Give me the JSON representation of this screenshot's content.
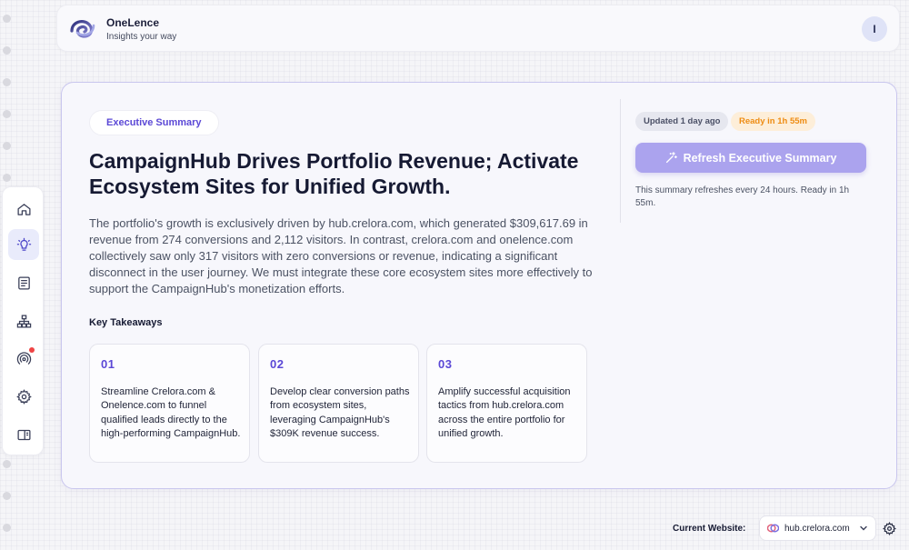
{
  "header": {
    "brand_name": "OneLence",
    "brand_tagline": "Insights your way",
    "avatar_initial": "I"
  },
  "sidebar": {
    "items": [
      {
        "icon": "home-icon",
        "active": false
      },
      {
        "icon": "lightbulb-icon",
        "active": true
      },
      {
        "icon": "document-icon",
        "active": false
      },
      {
        "icon": "sitemap-icon",
        "active": false
      },
      {
        "icon": "broadcast-icon",
        "active": false,
        "notification": true
      },
      {
        "icon": "gear-icon",
        "active": false
      },
      {
        "icon": "panel-layout-icon",
        "active": false
      }
    ]
  },
  "summary": {
    "pill_label": "Executive Summary",
    "headline": "CampaignHub Drives Portfolio Revenue; Activate Ecosystem Sites for Unified Growth.",
    "body": "The portfolio's growth is exclusively driven by hub.crelora.com, which generated $309,617.69 in revenue from 274 conversions and 2,112 visitors. In contrast, crelora.com and onelence.com collectively saw only 317 visitors with zero conversions or revenue, indicating a significant disconnect in the user journey. We must integrate these core ecosystem sites more effectively to support the CampaignHub's monetization efforts.",
    "takeaways_title": "Key Takeaways",
    "takeaways": [
      {
        "num": "01",
        "text": "Streamline Crelora.com & Onelence.com to funnel qualified leads directly to the high-performing CampaignHub."
      },
      {
        "num": "02",
        "text": "Develop clear conversion paths from ecosystem sites, leveraging CampaignHub's $309K revenue success."
      },
      {
        "num": "03",
        "text": "Amplify successful acquisition tactics from hub.crelora.com across the entire portfolio for unified growth."
      }
    ]
  },
  "status": {
    "updated": "Updated 1 day ago",
    "ready": "Ready in 1h 55m",
    "refresh_button": "Refresh Executive Summary",
    "refresh_note": "This summary refreshes every 24 hours. Ready in 1h 55m."
  },
  "footer": {
    "current_website_label": "Current Website:",
    "selected_site": "hub.crelora.com"
  },
  "colors": {
    "accent": "#5b48d6",
    "button_disabled": "#aba3ee",
    "ready_text": "#ee8c13",
    "notification": "#ef4444"
  }
}
